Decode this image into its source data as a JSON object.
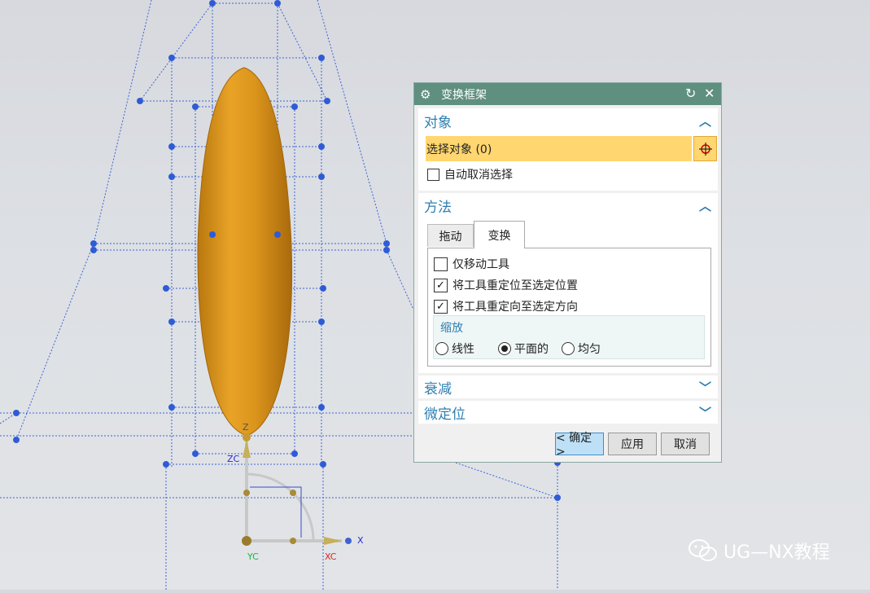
{
  "dialog": {
    "title": "变换框架",
    "sections": {
      "object": {
        "header": "对象",
        "select_label": "选择对象 (0)",
        "auto_deselect_label": "自动取消选择",
        "auto_deselect_checked": false
      },
      "method": {
        "header": "方法",
        "tabs": [
          "拖动",
          "变换"
        ],
        "active_tab": "变换",
        "options": [
          {
            "label": "仅移动工具",
            "checked": false
          },
          {
            "label": "将工具重定位至选定位置",
            "checked": true
          },
          {
            "label": "将工具重定向至选定方向",
            "checked": true
          }
        ],
        "scale": {
          "label": "缩放",
          "choices": [
            "线性",
            "平面的",
            "均匀"
          ],
          "selected": "平面的"
        }
      },
      "falloff": {
        "header": "衰减"
      },
      "finetune": {
        "header": "微定位"
      }
    },
    "buttons": {
      "ok": "< 确定 >",
      "apply": "应用",
      "cancel": "取消"
    }
  },
  "viewport": {
    "axis": {
      "z": "Z",
      "zc": "ZC",
      "x": "X",
      "yc": "YC",
      "xc": "XC"
    }
  },
  "watermark": {
    "text": "UG—NX教程"
  },
  "colors": {
    "title_bar": "#5f8f7f",
    "accent": "#2f7fb0",
    "highlight": "#ffd670",
    "shape": "#e29a1f",
    "handles": "#2f5bd6"
  }
}
